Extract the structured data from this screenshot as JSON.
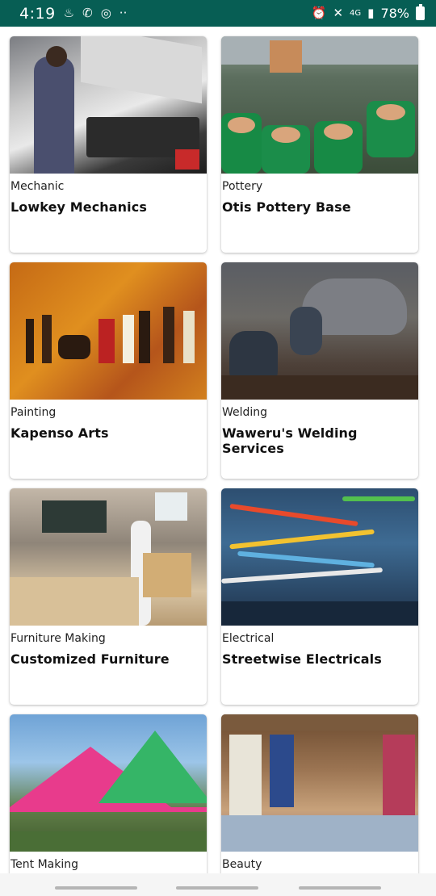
{
  "status_bar": {
    "time": "4:19",
    "network": "4G",
    "battery": "78%",
    "icons": [
      "notification-icon",
      "whatsapp-icon",
      "wifi-hotspot-icon",
      "more-dots-icon",
      "alarm-icon",
      "mute-icon",
      "signal-icon",
      "battery-icon"
    ]
  },
  "cards": [
    {
      "category": "Mechanic",
      "title": "Lowkey Mechanics",
      "image": "mechanic-photo"
    },
    {
      "category": "Pottery",
      "title": "Otis Pottery Base",
      "image": "pottery-photo"
    },
    {
      "category": "Painting",
      "title": "Kapenso Arts",
      "image": "painting-photo"
    },
    {
      "category": "Welding",
      "title": "Waweru's Welding Services",
      "image": "welding-photo"
    },
    {
      "category": "Furniture Making",
      "title": "Customized Furniture",
      "image": "furniture-photo"
    },
    {
      "category": "Electrical",
      "title": "Streetwise Electricals",
      "image": "electrical-photo"
    },
    {
      "category": "Tent Making",
      "title": "",
      "image": "tent-photo"
    },
    {
      "category": "Beauty",
      "title": "",
      "image": "beauty-photo"
    }
  ],
  "colors": {
    "status_bar": "#075e54",
    "background": "#ffffff"
  }
}
